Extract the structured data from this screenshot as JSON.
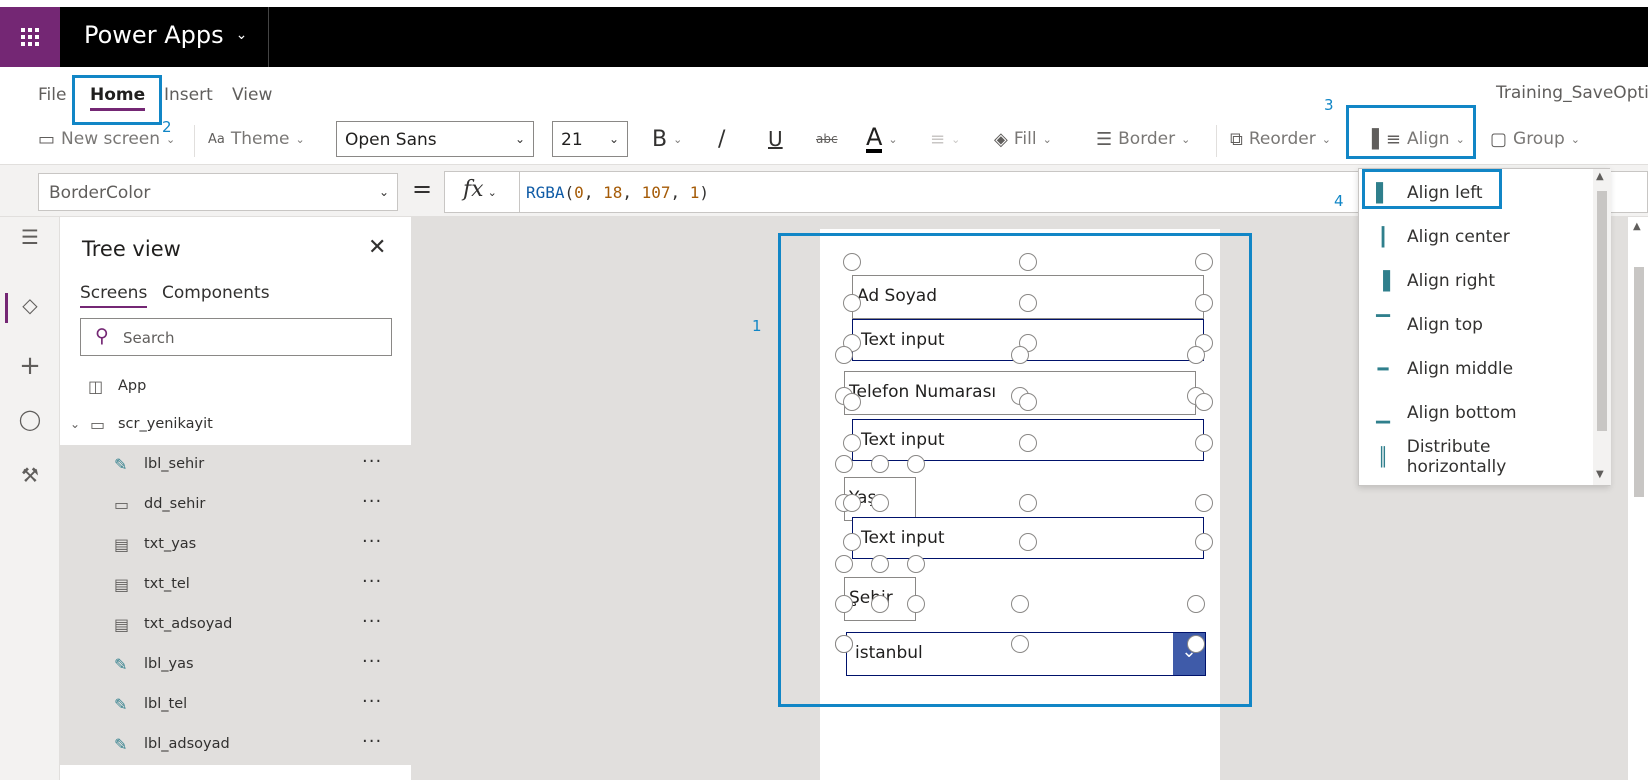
{
  "app": {
    "title": "Power Apps",
    "document_name": "Training_SaveOption"
  },
  "menu": {
    "items": [
      "File",
      "Home",
      "Insert",
      "View"
    ],
    "active": "Home"
  },
  "ribbon": {
    "new_screen": "New screen",
    "theme": "Theme",
    "font": "Open Sans",
    "font_size": "21",
    "bold": "B",
    "italic": "/",
    "underline": "U",
    "strike": "abc",
    "font_color_glyph": "A",
    "fill": "Fill",
    "border": "Border",
    "reorder": "Reorder",
    "align": "Align",
    "group": "Group"
  },
  "formula": {
    "property": "BorderColor",
    "equals": "=",
    "fx": "fx",
    "func": "RGBA",
    "open": "(",
    "args": [
      "0",
      "18",
      "107",
      "1"
    ],
    "close": ")"
  },
  "tree_view": {
    "title": "Tree view",
    "tabs": [
      "Screens",
      "Components"
    ],
    "search_placeholder": "Search",
    "app_label": "App",
    "screen_name": "scr_yenikayit",
    "more": "···",
    "items": [
      {
        "name": "lbl_sehir",
        "icon": "label-icon"
      },
      {
        "name": "dd_sehir",
        "icon": "dropdown-icon"
      },
      {
        "name": "txt_yas",
        "icon": "text-input-icon"
      },
      {
        "name": "txt_tel",
        "icon": "text-input-icon"
      },
      {
        "name": "txt_adsoyad",
        "icon": "text-input-icon"
      },
      {
        "name": "lbl_yas",
        "icon": "label-icon"
      },
      {
        "name": "lbl_tel",
        "icon": "label-icon"
      },
      {
        "name": "lbl_adsoyad",
        "icon": "label-icon"
      }
    ]
  },
  "canvas": {
    "controls": {
      "lbl_adsoyad": "Ad Soyad",
      "txt_adsoyad": "Text input",
      "lbl_tel": "Telefon Numarası",
      "txt_tel": "Text input",
      "lbl_yas": "Yaş",
      "txt_yas": "Text input",
      "lbl_sehir": "Şehir",
      "dd_sehir": "istanbul"
    }
  },
  "align_menu": {
    "items": [
      "Align left",
      "Align center",
      "Align right",
      "Align top",
      "Align middle",
      "Align bottom",
      "Distribute horizontally"
    ]
  },
  "annotations": {
    "step1": "1",
    "step2": "2",
    "step3": "3",
    "step4": "4",
    "color": "#1186c6"
  },
  "colors": {
    "brand": "#742774",
    "appbar": "#000000",
    "input_border": "#00126b",
    "dropdown_button": "#3f5ba9"
  }
}
